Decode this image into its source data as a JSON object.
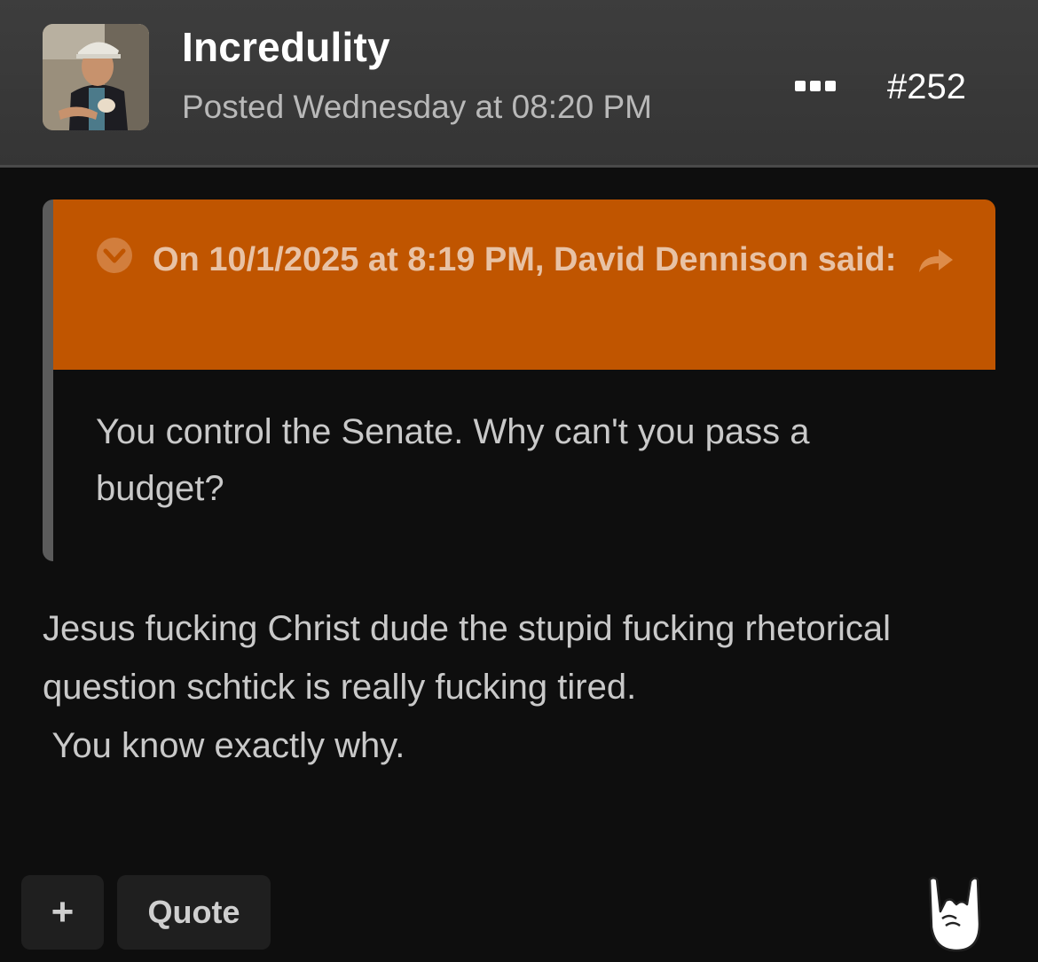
{
  "post": {
    "author": "Incredulity",
    "posted": "Posted Wednesday at 08:20 PM",
    "number": "#252",
    "avatar_icon": "user-avatar-photo",
    "more_icon": "ellipsis-icon"
  },
  "quote": {
    "citation": "On 10/1/2025 at 8:19 PM, David Dennison said:",
    "text": "You control the Senate. Why can't you pass a budget?",
    "header_color": "#c05500",
    "toggle_icon": "chevron-down-circle-icon",
    "share_icon": "share-arrow-icon"
  },
  "body": {
    "line1": "Jesus fucking Christ dude the stupid fucking rhetorical question schtick is really fucking tired.",
    "line2": " You know exactly why."
  },
  "actions": {
    "add_label": "+",
    "quote_label": "Quote",
    "reaction_icon": "rock-on-hand-icon"
  }
}
